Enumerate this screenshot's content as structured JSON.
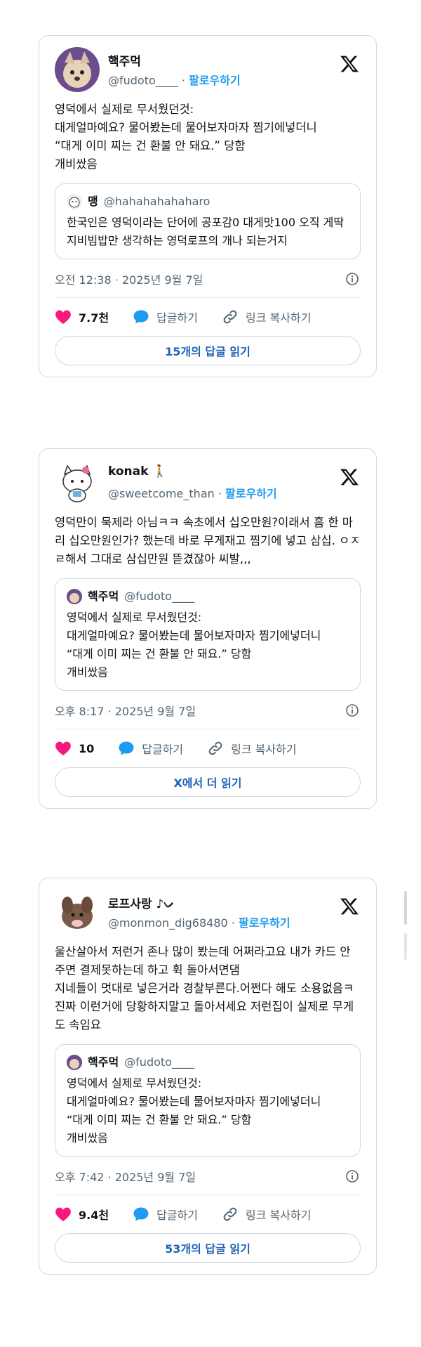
{
  "posts": [
    {
      "name": "핵주먹",
      "handle": "@fudoto____",
      "sep": "·",
      "follow": "팔로우하기",
      "text": "영덕에서 실제로 무서웠던것:\n대게얼마예요? 물어봤는데 물어보자마자 찜기에넣더니\n“대게 이미 찌는 건 환불 안 돼요.” 당함\n개비쌌음",
      "quote": {
        "name": "맹",
        "handle": "@hahahahahaharo",
        "text": "한국인은 영덕이라는 단어에 공포감0 대게맛100 오직 게딱지비빔밥만 생각하는 영덕로프의 개나 되는거지"
      },
      "meta": "오전 12:38 · 2025년 9월 7일",
      "likes": "7.7천",
      "reply_label": "답글하기",
      "copy_label": "링크 복사하기",
      "read_button": "15개의 답글 읽기",
      "avatar_color": "#b88a6a"
    },
    {
      "name": "konak",
      "name_emoji": "🚶",
      "handle": "@sweetcome_than",
      "sep": "·",
      "follow": "팔로우하기",
      "text": "영덕만이 묵제라 아님ㅋㅋ 속초에서 십오만원?이래서 흠 한 마리 십오만원인가? 했는데 바로 무게재고 찜기에 넣고 삼십. ㅇㅈㄹ해서 그대로 삼십만원 뜯겼잖아 씨발,,,",
      "quote": {
        "name": "핵주먹",
        "handle": "@fudoto____",
        "text": "영덕에서 실제로 무서웠던것:\n대게얼마예요? 물어봤는데 물어보자마자 찜기에넣더니\n“대게 이미 찌는 건 환불 안 돼요.” 당함\n개비쌌음"
      },
      "meta": "오후 8:17 · 2025년 9월 7일",
      "likes": "10",
      "reply_label": "답글하기",
      "copy_label": "링크 복사하기",
      "read_button": "X에서 더 읽기",
      "avatar_color": "#f2f2f2"
    },
    {
      "name": "로프사랑",
      "name_emoji": "♪ᨆ",
      "handle": "@monmon_dig68480",
      "sep": "·",
      "follow": "팔로우하기",
      "text": "울산살아서 저런거 존나 많이 봤는데 어쩌라고요 내가 카드 안주면 결제못하는데 하고 휙 돌아서면댐\n지네들이 멋대로 넣은거라 경찰부른다.어쩐다 해도 소용없음ㅋ 진짜 이런거에 당황하지말고 돌아서세요 저런집이 실제로 무게도 속임요",
      "quote": {
        "name": "핵주먹",
        "handle": "@fudoto____",
        "text": "영덕에서 실제로 무서웠던것:\n대게얼마예요? 물어봤는데 물어보자마자 찜기에넣더니\n“대게 이미 찌는 건 환불 안 돼요.” 당함\n개비쌌음"
      },
      "meta": "오후 7:42 · 2025년 9월 7일",
      "likes": "9.4천",
      "reply_label": "답글하기",
      "copy_label": "링크 복사하기",
      "read_button": "53개의 답글 읽기",
      "avatar_color": "#8a6a5a"
    }
  ],
  "colors": {
    "accent": "#1d9bf0",
    "heart": "#f91880",
    "reply": "#1d9bf0",
    "border": "#cfd9de"
  }
}
